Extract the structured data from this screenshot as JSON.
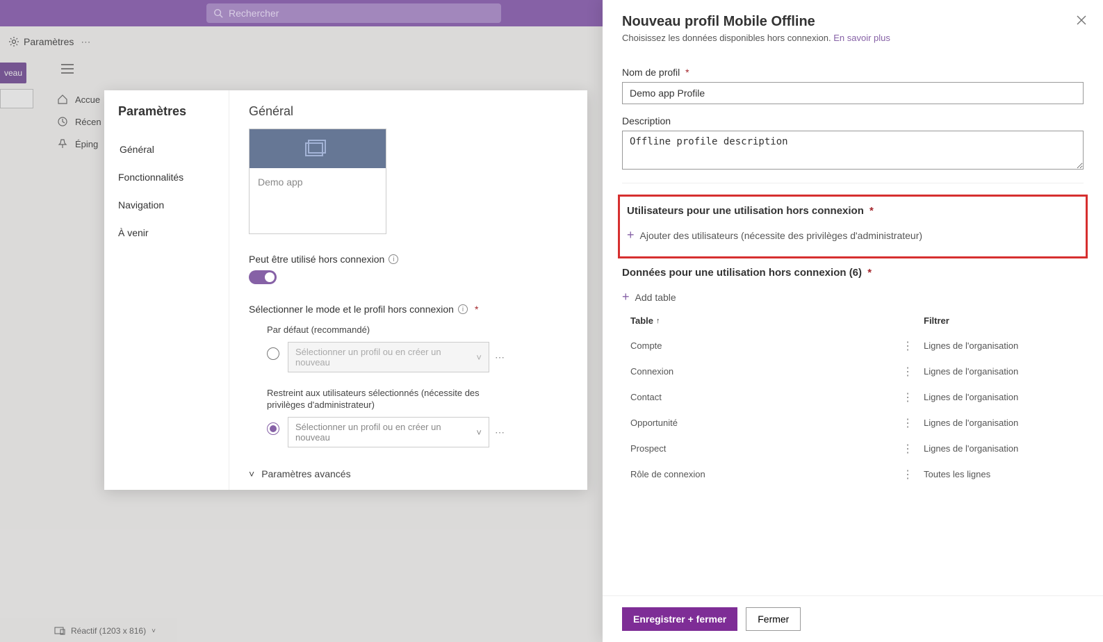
{
  "search": {
    "placeholder": "Rechercher"
  },
  "secbar": {
    "settings": "Paramètres"
  },
  "left_btn": "veau",
  "leftnav": {
    "home": "Accue",
    "recent": "Récen",
    "pinned": "Éping"
  },
  "settings_panel": {
    "title": "Paramètres",
    "tabs": {
      "general": "Général",
      "features": "Fonctionnalités",
      "navigation": "Navigation",
      "upcoming": "À venir"
    },
    "main": {
      "heading": "Général",
      "app_name": "Demo app",
      "offline_label": "Peut être utilisé hors connexion",
      "mode_label": "Sélectionner le mode et le profil hors connexion",
      "option1": "Par défaut (recommandé)",
      "option2_l1": "Restreint aux utilisateurs sélectionnés (nécessite des",
      "option2_l2": "privilèges d'administrateur)",
      "select_placeholder": "Sélectionner un profil ou en créer un nouveau",
      "advanced": "Paramètres avancés"
    }
  },
  "bottom": {
    "reactive": "Réactif (1203 x 816)"
  },
  "panel": {
    "title": "Nouveau profil Mobile Offline",
    "subtitle": "Choisissez les données disponibles hors connexion.",
    "learn_more": "En savoir plus",
    "name_label": "Nom de profil",
    "name_value": "Demo app Profile",
    "desc_label": "Description",
    "desc_value": "Offline profile description",
    "users_title": "Utilisateurs pour une utilisation hors connexion",
    "add_users": "Ajouter des utilisateurs (nécessite des privilèges d'administrateur)",
    "data_title": "Données pour une utilisation hors connexion (6)",
    "add_table": "Add table",
    "th_table": "Table",
    "th_filter": "Filtrer",
    "rows": [
      {
        "table": "Compte",
        "filter": "Lignes de l'organisation"
      },
      {
        "table": "Connexion",
        "filter": "Lignes de l'organisation"
      },
      {
        "table": "Contact",
        "filter": "Lignes de l'organisation"
      },
      {
        "table": "Opportunité",
        "filter": "Lignes de l'organisation"
      },
      {
        "table": "Prospect",
        "filter": "Lignes de l'organisation"
      },
      {
        "table": "Rôle de connexion",
        "filter": "Toutes les lignes"
      }
    ],
    "save": "Enregistrer + fermer",
    "close": "Fermer"
  }
}
